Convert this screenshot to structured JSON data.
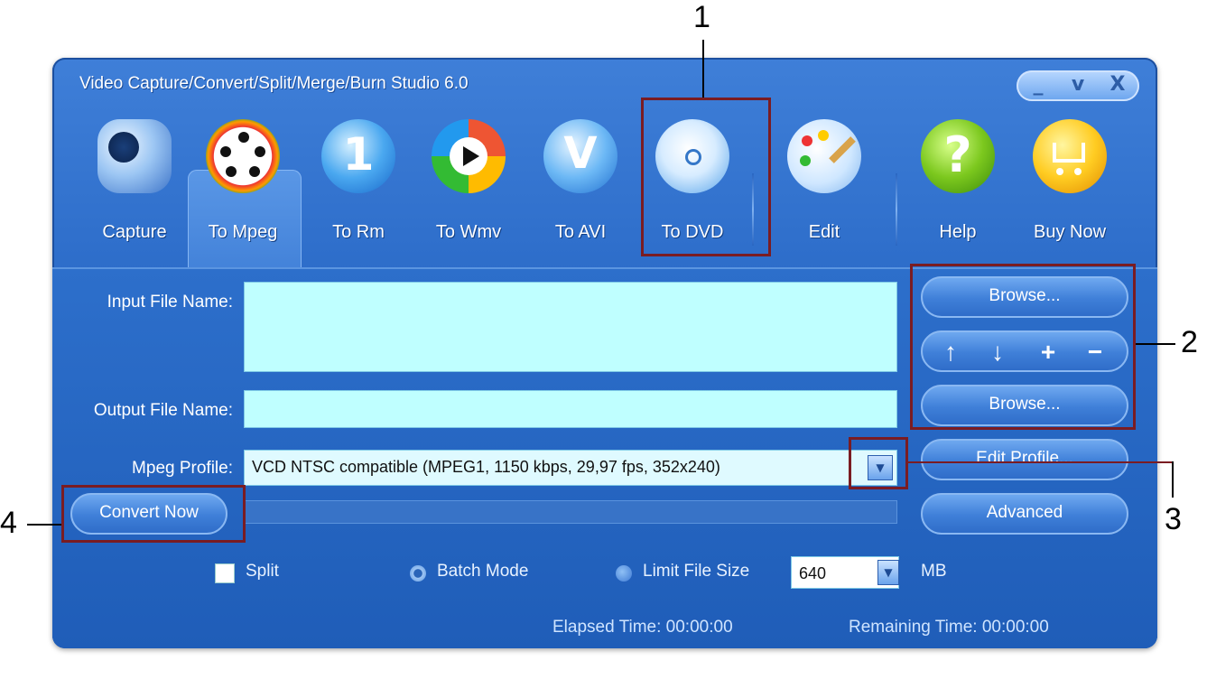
{
  "window": {
    "title": "Video Capture/Convert/Split/Merge/Burn Studio 6.0",
    "controls": [
      "_",
      "v",
      "X"
    ]
  },
  "toolbar": {
    "items": [
      {
        "label": "Capture",
        "icon": "camcorder-icon"
      },
      {
        "label": "To Mpeg",
        "icon": "film-reel-icon",
        "selected": true
      },
      {
        "label": "To Rm",
        "icon": "realmedia-icon"
      },
      {
        "label": "To Wmv",
        "icon": "windows-media-icon"
      },
      {
        "label": "To AVI",
        "icon": "avi-v-icon"
      },
      {
        "label": "To DVD",
        "icon": "dvd-disc-icon"
      },
      {
        "label": "Edit",
        "icon": "paint-palette-icon"
      },
      {
        "label": "Help",
        "icon": "help-question-icon"
      },
      {
        "label": "Buy Now",
        "icon": "shopping-cart-icon"
      }
    ]
  },
  "form": {
    "input_label": "Input File Name:",
    "output_label": "Output File Name:",
    "profile_label": "Mpeg Profile:",
    "profile_value": "VCD NTSC compatible (MPEG1, 1150 kbps, 29,97 fps, 352x240)"
  },
  "side_buttons": {
    "browse_input": "Browse...",
    "move_up": "↑",
    "move_down": "↓",
    "add": "+",
    "remove": "−",
    "browse_output": "Browse...",
    "edit_profile": "Edit Profile...",
    "advanced": "Advanced"
  },
  "convert_button": "Convert Now",
  "options": {
    "split_label": "Split",
    "batch_label": "Batch Mode",
    "limit_label": "Limit File Size",
    "size_value": "640",
    "size_unit": "MB"
  },
  "status": {
    "elapsed": "Elapsed Time: 00:00:00",
    "remaining": "Remaining Time: 00:00:00"
  },
  "callouts": [
    "1",
    "2",
    "3",
    "4"
  ],
  "colors": {
    "window_blue": "#2b6bc8",
    "field_cyan": "#bfffff",
    "callout_red": "#7a1c22"
  }
}
